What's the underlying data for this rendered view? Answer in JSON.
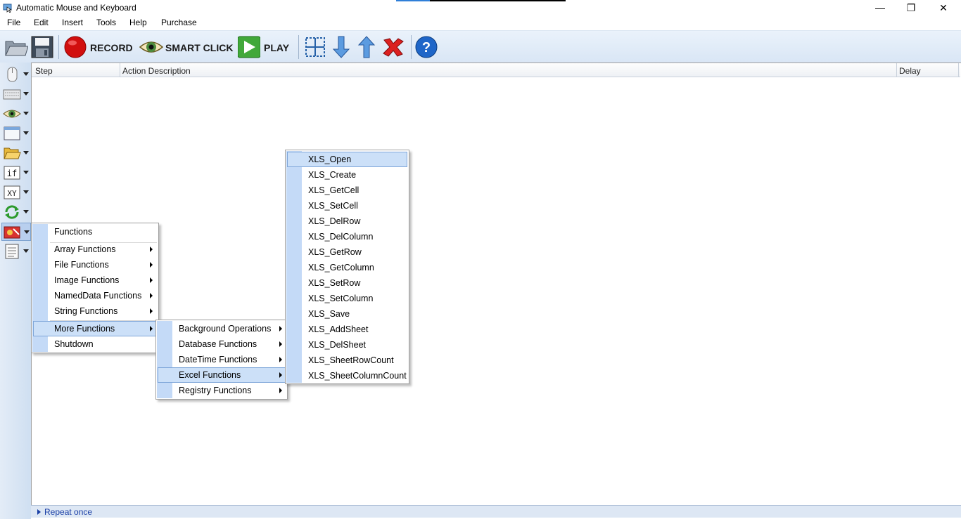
{
  "window": {
    "title": "Automatic Mouse and Keyboard"
  },
  "menubar": [
    "File",
    "Edit",
    "Insert",
    "Tools",
    "Help",
    "Purchase"
  ],
  "toolbar": {
    "record": "RECORD",
    "smart_click": "SMART CLICK",
    "play": "PLAY"
  },
  "grid": {
    "columns": [
      "Step",
      "Action Description",
      "Delay"
    ]
  },
  "status": {
    "repeat": "Repeat once"
  },
  "menu1": {
    "items": [
      "Functions",
      "Array Functions",
      "File Functions",
      "Image Functions",
      "NamedData Functions",
      "String Functions",
      "More Functions",
      "Shutdown"
    ],
    "highlighted": "More Functions"
  },
  "menu2": {
    "items": [
      "Background Operations",
      "Database Functions",
      "DateTime Functions",
      "Excel Functions",
      "Registry Functions"
    ],
    "highlighted": "Excel Functions"
  },
  "menu3": {
    "items": [
      "XLS_Open",
      "XLS_Create",
      "XLS_GetCell",
      "XLS_SetCell",
      "XLS_DelRow",
      "XLS_DelColumn",
      "XLS_GetRow",
      "XLS_GetColumn",
      "XLS_SetRow",
      "XLS_SetColumn",
      "XLS_Save",
      "XLS_AddSheet",
      "XLS_DelSheet",
      "XLS_SheetRowCount",
      "XLS_SheetColumnCount"
    ],
    "highlighted": "XLS_Open"
  },
  "icons": {
    "toolbar": [
      "open-folder-icon",
      "save-icon",
      "record-icon",
      "smart-click-eye-icon",
      "play-icon",
      "select-region-icon",
      "move-down-icon",
      "move-up-icon",
      "delete-icon",
      "help-icon"
    ],
    "left": [
      "mouse-icon",
      "keyboard-icon",
      "eye-icon",
      "window-icon",
      "folder-icon",
      "if-icon",
      "xy-icon",
      "loop-icon",
      "functions-icon",
      "script-icon"
    ]
  },
  "colors": {
    "accent": "#c4daf7",
    "highlight": "#cce0f8",
    "status_text": "#1a3fa6"
  }
}
